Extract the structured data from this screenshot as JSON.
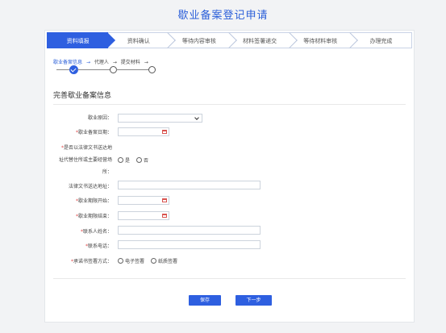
{
  "page": {
    "title": "歇业备案登记申请"
  },
  "steps": [
    {
      "label": "资料填报",
      "active": true
    },
    {
      "label": "资料确认",
      "active": false
    },
    {
      "label": "等待内容审核",
      "active": false
    },
    {
      "label": "材料签署递交",
      "active": false
    },
    {
      "label": "等待材料审核",
      "active": false
    },
    {
      "label": "办理完成",
      "active": false
    }
  ],
  "substeps": {
    "items": [
      "歇业备案信息",
      "代理人",
      "提交材料"
    ],
    "arrow": "→"
  },
  "section": {
    "title": "完善歇业备案信息"
  },
  "form": {
    "reason_label": "歇业原因：",
    "reason_value": "",
    "date_label": "歇业备案日期：",
    "service_address_q_line1": "是否以法律文书送达地",
    "service_address_q_line2": "址代替住所或主要经营场",
    "service_address_q_line3": "所：",
    "opt_yes": "是",
    "opt_no": "否",
    "legal_address_label": "法律文书送达地址：",
    "period_start_label": "歇业期限开始：",
    "period_end_label": "歇业期限结束：",
    "contact_name_label": "联系人姓名：",
    "contact_phone_label": "联系电话：",
    "sign_method_label": "承诺书签署方式：",
    "opt_electronic": "电子签署",
    "opt_paper": "纸质签署",
    "required_mark": "*"
  },
  "buttons": {
    "save": "保存",
    "next": "下一步"
  },
  "colors": {
    "accent": "#2e5fe0",
    "title": "#2b5fd9",
    "required": "#e04848"
  }
}
